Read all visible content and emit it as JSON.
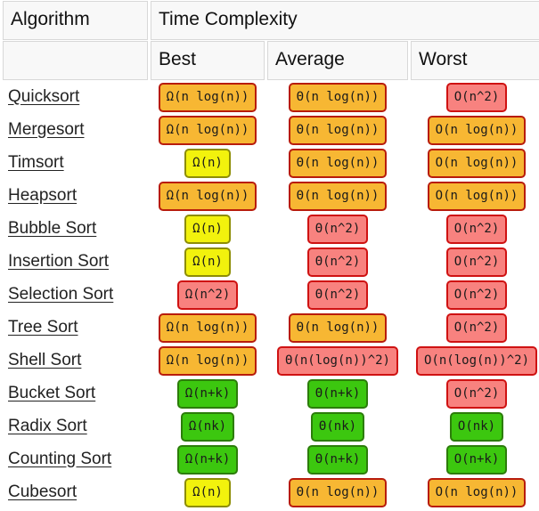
{
  "table": {
    "header": {
      "algorithm_label": "Algorithm",
      "group_label": "Time Complexity",
      "blank_label": "",
      "columns": [
        "Best",
        "Average",
        "Worst"
      ]
    },
    "rows": [
      {
        "algorithm": "Quicksort",
        "best": {
          "text": "Ω(n log(n))",
          "color": "orange"
        },
        "average": {
          "text": "Θ(n log(n))",
          "color": "orange"
        },
        "worst": {
          "text": "O(n^2)",
          "color": "red"
        }
      },
      {
        "algorithm": "Mergesort",
        "best": {
          "text": "Ω(n log(n))",
          "color": "orange"
        },
        "average": {
          "text": "Θ(n log(n))",
          "color": "orange"
        },
        "worst": {
          "text": "O(n log(n))",
          "color": "orange"
        }
      },
      {
        "algorithm": "Timsort",
        "best": {
          "text": "Ω(n)",
          "color": "yellow"
        },
        "average": {
          "text": "Θ(n log(n))",
          "color": "orange"
        },
        "worst": {
          "text": "O(n log(n))",
          "color": "orange"
        }
      },
      {
        "algorithm": "Heapsort",
        "best": {
          "text": "Ω(n log(n))",
          "color": "orange"
        },
        "average": {
          "text": "Θ(n log(n))",
          "color": "orange"
        },
        "worst": {
          "text": "O(n log(n))",
          "color": "orange"
        }
      },
      {
        "algorithm": "Bubble Sort",
        "best": {
          "text": "Ω(n)",
          "color": "yellow"
        },
        "average": {
          "text": "Θ(n^2)",
          "color": "red"
        },
        "worst": {
          "text": "O(n^2)",
          "color": "red"
        }
      },
      {
        "algorithm": "Insertion Sort",
        "best": {
          "text": "Ω(n)",
          "color": "yellow"
        },
        "average": {
          "text": "Θ(n^2)",
          "color": "red"
        },
        "worst": {
          "text": "O(n^2)",
          "color": "red"
        }
      },
      {
        "algorithm": "Selection Sort",
        "best": {
          "text": "Ω(n^2)",
          "color": "red"
        },
        "average": {
          "text": "Θ(n^2)",
          "color": "red"
        },
        "worst": {
          "text": "O(n^2)",
          "color": "red"
        }
      },
      {
        "algorithm": "Tree Sort",
        "best": {
          "text": "Ω(n log(n))",
          "color": "orange"
        },
        "average": {
          "text": "Θ(n log(n))",
          "color": "orange"
        },
        "worst": {
          "text": "O(n^2)",
          "color": "red"
        }
      },
      {
        "algorithm": "Shell Sort",
        "best": {
          "text": "Ω(n log(n))",
          "color": "orange"
        },
        "average": {
          "text": "Θ(n(log(n))^2)",
          "color": "red"
        },
        "worst": {
          "text": "O(n(log(n))^2)",
          "color": "red"
        }
      },
      {
        "algorithm": "Bucket Sort",
        "best": {
          "text": "Ω(n+k)",
          "color": "green"
        },
        "average": {
          "text": "Θ(n+k)",
          "color": "green"
        },
        "worst": {
          "text": "O(n^2)",
          "color": "red"
        }
      },
      {
        "algorithm": "Radix Sort",
        "best": {
          "text": "Ω(nk)",
          "color": "green"
        },
        "average": {
          "text": "Θ(nk)",
          "color": "green"
        },
        "worst": {
          "text": "O(nk)",
          "color": "green"
        }
      },
      {
        "algorithm": "Counting Sort",
        "best": {
          "text": "Ω(n+k)",
          "color": "green"
        },
        "average": {
          "text": "Θ(n+k)",
          "color": "green"
        },
        "worst": {
          "text": "O(n+k)",
          "color": "green"
        }
      },
      {
        "algorithm": "Cubesort",
        "best": {
          "text": "Ω(n)",
          "color": "yellow"
        },
        "average": {
          "text": "Θ(n log(n))",
          "color": "orange"
        },
        "worst": {
          "text": "O(n log(n))",
          "color": "orange"
        }
      }
    ]
  },
  "colors": {
    "orange_fill": "#f7b733",
    "orange_border": "#b81c0c",
    "yellow_fill": "#f2f20d",
    "yellow_border": "#8d8d06",
    "red_fill": "#f8827f",
    "red_border": "#cf1212",
    "green_fill": "#3cc70f",
    "green_border": "#2c7d0a",
    "header_bg": "#f8f8f8"
  }
}
